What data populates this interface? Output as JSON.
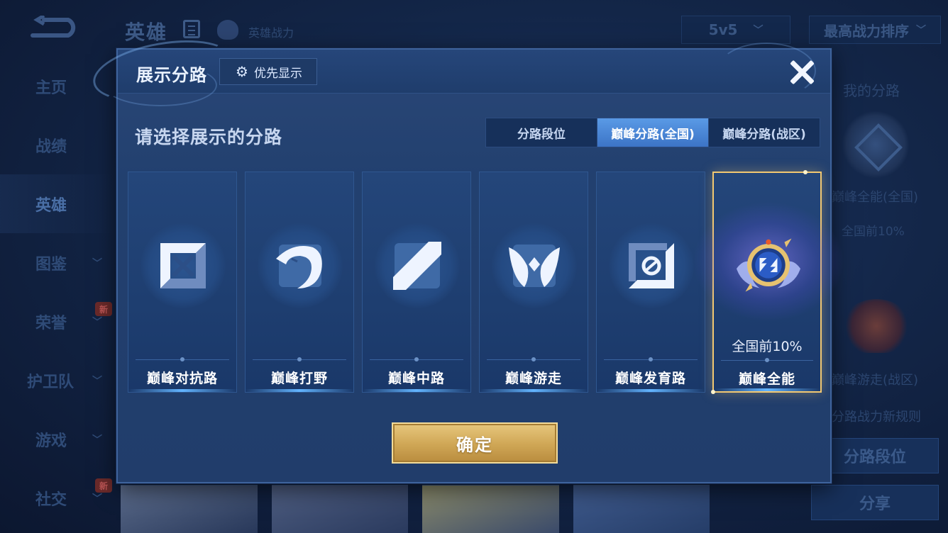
{
  "background": {
    "header_title": "英雄",
    "header_subtitle": "英雄战力",
    "mode_select": "5v5",
    "sort_select": "最高战力排序",
    "sidebar": [
      {
        "label": "主页",
        "has_chevron": false,
        "badge": ""
      },
      {
        "label": "战绩",
        "has_chevron": false,
        "badge": ""
      },
      {
        "label": "英雄",
        "has_chevron": false,
        "badge": "",
        "active": true
      },
      {
        "label": "图鉴",
        "has_chevron": true,
        "badge": ""
      },
      {
        "label": "荣誉",
        "has_chevron": true,
        "badge": "新"
      },
      {
        "label": "护卫队",
        "has_chevron": true,
        "badge": ""
      },
      {
        "label": "游戏",
        "has_chevron": true,
        "badge": ""
      },
      {
        "label": "社交",
        "has_chevron": true,
        "badge": "新"
      }
    ],
    "right_panel": {
      "title": "我的分路",
      "badge1_label": "巅峰全能(全国)",
      "badge1_rank": "全国前10%",
      "badge2_label": "巅峰游走(战区)",
      "rules_link": "分路战力新规则",
      "lane_rank_button": "分路段位",
      "share_button": "分享"
    }
  },
  "modal": {
    "title": "展示分路",
    "priority_button": "优先显示",
    "prompt": "请选择展示的分路",
    "tabs": [
      {
        "label": "分路段位",
        "active": false
      },
      {
        "label": "巅峰分路(全国)",
        "active": true
      },
      {
        "label": "巅峰分路(战区)",
        "active": false
      }
    ],
    "lanes": [
      {
        "name": "巅峰对抗路",
        "icon": "sword-shield-icon",
        "rank": "",
        "selected": false
      },
      {
        "name": "巅峰打野",
        "icon": "dragon-icon",
        "rank": "",
        "selected": false
      },
      {
        "name": "巅峰中路",
        "icon": "staff-icon",
        "rank": "",
        "selected": false
      },
      {
        "name": "巅峰游走",
        "icon": "wings-icon",
        "rank": "",
        "selected": false
      },
      {
        "name": "巅峰发育路",
        "icon": "crosshair-icon",
        "rank": "",
        "selected": false
      },
      {
        "name": "巅峰全能",
        "icon": "all-round-emblem-icon",
        "rank": "全国前10%",
        "selected": true
      }
    ],
    "confirm_button": "确定"
  },
  "colors": {
    "accent_blue": "#4a88d8",
    "gold": "#d4ad5c",
    "selected_border": "#f2c871"
  }
}
